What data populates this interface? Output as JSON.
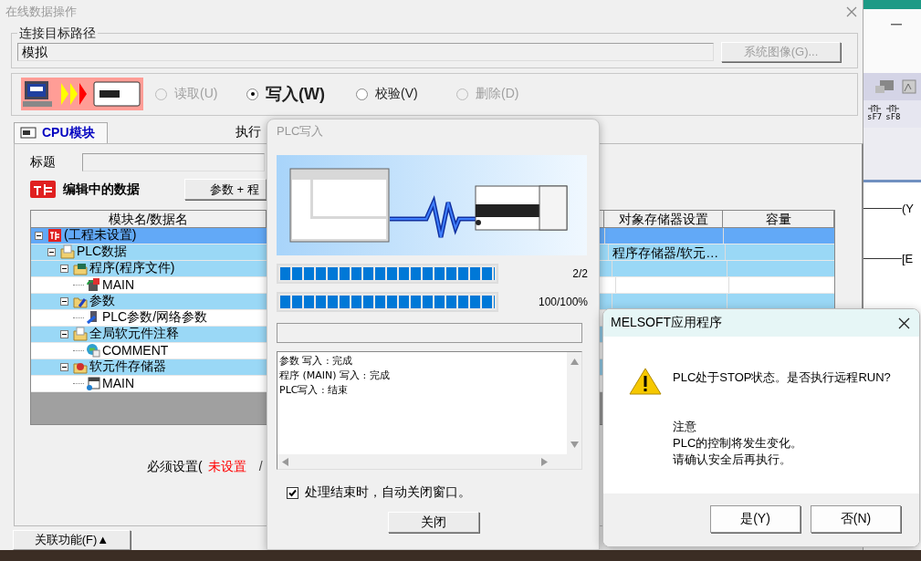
{
  "main_window": {
    "title": "在线数据操作",
    "connection": {
      "label": "连接目标路径",
      "value": "模拟",
      "button": {
        "label": "系统图像(G)...",
        "disabled": true
      }
    },
    "operations": [
      {
        "label": "读取(U)",
        "selected": false,
        "disabled": true
      },
      {
        "label": "写入(W)",
        "selected": true,
        "disabled": false
      },
      {
        "label": "校验(V)",
        "selected": false,
        "disabled": false
      },
      {
        "label": "删除(D)",
        "selected": false,
        "disabled": true
      }
    ],
    "tabs": [
      {
        "label": "CPU模块",
        "selected": true
      }
    ],
    "execute_label": "执行",
    "title_field": {
      "label": "标题"
    },
    "editing_data": {
      "label": "编辑中的数据",
      "button": "参数 + 程"
    },
    "table": {
      "columns": [
        "模块名/数据名",
        "对象存储器设置",
        "容量"
      ],
      "rows": [
        {
          "label": "(工程未设置)",
          "kind": "project",
          "expanded": true,
          "children": [
            {
              "label": "PLC数据",
              "kind": "data",
              "expanded": true,
              "memory": "程序存储器/软元…",
              "children": [
                {
                  "label": "程序(程序文件)",
                  "kind": "program_folder",
                  "expanded": true,
                  "children": [
                    {
                      "label": "MAIN",
                      "kind": "program"
                    }
                  ]
                },
                {
                  "label": "参数",
                  "kind": "parameter_folder",
                  "expanded": true,
                  "children": [
                    {
                      "label": "PLC参数/网络参数",
                      "kind": "parameter"
                    }
                  ]
                },
                {
                  "label": "全局软元件注释",
                  "kind": "comment_folder",
                  "expanded": true,
                  "children": [
                    {
                      "label": "COMMENT",
                      "kind": "comment"
                    }
                  ]
                },
                {
                  "label": "软元件存储器",
                  "kind": "device_folder",
                  "expanded": true,
                  "children": [
                    {
                      "label": "MAIN",
                      "kind": "device"
                    }
                  ]
                }
              ]
            }
          ]
        }
      ]
    },
    "required": {
      "label": "必须设置(",
      "status": "未设置",
      "separator": "/"
    },
    "related_button": "关联功能(F)▲"
  },
  "plc_write_dialog": {
    "title": "PLC写入",
    "progress": [
      {
        "level": 1,
        "reading": "2/2"
      },
      {
        "level": 1,
        "reading": "100/100%"
      },
      {
        "level": 0
      }
    ],
    "log": [
      "参数 写入 : 完成",
      "程序 (MAIN) 写入 : 完成",
      "PLC写入 : 结束"
    ],
    "auto_close": {
      "label": "处理结束时，自动关闭窗口。",
      "checked": true
    },
    "close_button": "关闭"
  },
  "message_dialog": {
    "title": "MELSOFT应用程序",
    "message": "PLC处于STOP状态。是否执行远程RUN?",
    "notes": [
      "注意",
      "PLC的控制将发生变化。",
      "请确认安全后再执行。"
    ],
    "buttons": [
      "是(Y)",
      "否(N)"
    ]
  },
  "background_app": {
    "shortcuts": [
      "sF7",
      "sF8"
    ],
    "ladder": [
      "(Y",
      "[E"
    ]
  }
}
